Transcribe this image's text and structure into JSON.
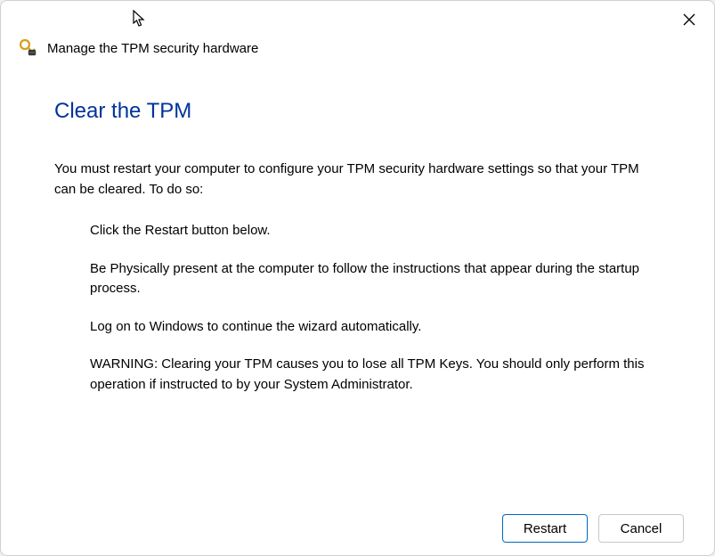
{
  "header": {
    "title": "Manage the TPM security hardware",
    "icon": "tpm-key-icon"
  },
  "content": {
    "title": "Clear the TPM",
    "intro": "You must restart your computer to configure your TPM security hardware settings so that your TPM can be cleared. To do so:",
    "steps": {
      "step1": "Click the Restart button below.",
      "step2": "Be Physically present at the computer to follow the instructions that appear during the startup process.",
      "step3": "Log on to Windows to continue the wizard automatically.",
      "step4": "WARNING: Clearing your TPM causes you to lose all TPM Keys. You should only perform this operation if instructed to by your System Administrator."
    }
  },
  "buttons": {
    "restart": "Restart",
    "cancel": "Cancel"
  }
}
